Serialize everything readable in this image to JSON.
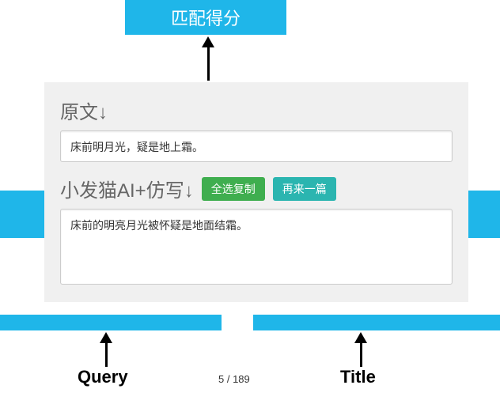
{
  "score_box": "匹配得分",
  "panel": {
    "original_label": "原文↓",
    "original_text": "床前明月光，疑是地上霜。",
    "rewrite_label": "小发猫AI+仿写↓",
    "btn_select_copy": "全选复制",
    "btn_regen": "再来一篇",
    "rewrite_text": "床前的明亮月光被怀疑是地面结霜。"
  },
  "labels": {
    "query": "Query",
    "title": "Title"
  },
  "page": "5 / 189"
}
